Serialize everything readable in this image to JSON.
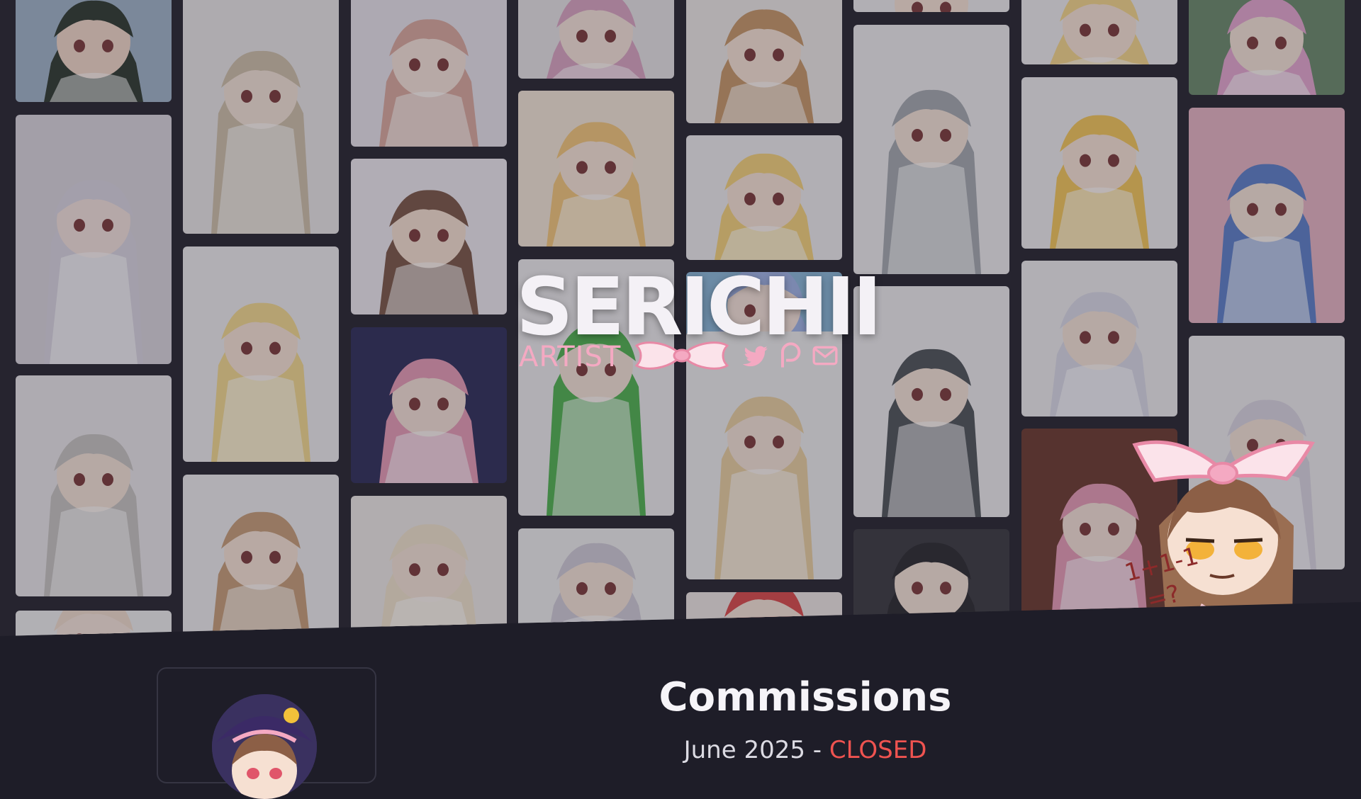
{
  "brand": {
    "name": "SERICHII",
    "role": "ARTIST",
    "colors": {
      "name": "#f4f1f6",
      "role": "#f4a9c2",
      "accent": "#f4a9c2"
    }
  },
  "social": [
    {
      "icon": "twitter-icon"
    },
    {
      "icon": "patreon-icon"
    },
    {
      "icon": "mail-icon"
    }
  ],
  "gallery": {
    "tiles": [
      {
        "bg": "#9fb4c8",
        "hair": "#2f3a30",
        "skin": "#f1d7c8"
      },
      {
        "bg": "#d8d5dc",
        "hair": "#d9d5e0",
        "skin": "#f3e1dc"
      },
      {
        "bg": "#e9e6e8",
        "hair": "#c6c3c0",
        "skin": "#f4e2d6"
      },
      {
        "bg": "#ececec",
        "hair": "#f0dccc",
        "skin": "#f5e4da"
      },
      {
        "bg": "#e8e5e6",
        "hair": "#cdbfa8",
        "skin": "#f3e2d6"
      },
      {
        "bg": "#ecebed",
        "hair": "#f2d98e",
        "skin": "#f6e3d4"
      },
      {
        "bg": "#ecebed",
        "hair": "#c69d77",
        "skin": "#f6e3d4"
      },
      {
        "bg": "#e7e3ea",
        "hair": "#d9a89c",
        "skin": "#f5e2d8"
      },
      {
        "bg": "#ece9ee",
        "hair": "#7a5747",
        "skin": "#f5e0d0"
      },
      {
        "bg": "#2e2e5a",
        "hair": "#e59bb5",
        "skin": "#f4e0d6"
      },
      {
        "bg": "#ece9e6",
        "hair": "#f0e2cc",
        "skin": "#f4e2d6"
      },
      {
        "bg": "#e6e2e4",
        "hair": "#d9a4c1",
        "skin": "#f5e2d8"
      },
      {
        "bg": "#f3e6d6",
        "hair": "#f2c67a",
        "skin": "#f6e4d6"
      },
      {
        "bg": "#ecebed",
        "hair": "#4fb24f",
        "skin": "#f4e2d6"
      },
      {
        "bg": "#ececec",
        "hair": "#cfcbd6",
        "skin": "#f4e2d6"
      },
      {
        "bg": "#ece8e6",
        "hair": "#c69768",
        "skin": "#f6e3d4"
      },
      {
        "bg": "#ecebed",
        "hair": "#f4d27a",
        "skin": "#f6e3d4"
      },
      {
        "bg": "#8ab8d8",
        "hair": "#9fb4e6",
        "skin": "#f5e2d8"
      },
      {
        "bg": "#ececec",
        "hair": "#e8cfa0",
        "skin": "#f4e2d6"
      },
      {
        "bg": "#ede6e2",
        "hair": "#d94a4a",
        "skin": "#f4e2d6"
      },
      {
        "bg": "#ecebed",
        "hair": "#f4d68a",
        "skin": "#f6e3d4"
      },
      {
        "bg": "#ecebed",
        "hair": "#a4a8ae",
        "skin": "#f4e2d6"
      },
      {
        "bg": "#ecebed",
        "hair": "#4e5358",
        "skin": "#f4e2d6"
      },
      {
        "bg": "#3a3a40",
        "hair": "#2a2a2e",
        "skin": "#f4e2d6"
      },
      {
        "bg": "#ecebed",
        "hair": "#f4d68a",
        "skin": "#f6e3d4"
      },
      {
        "bg": "#ecebed",
        "hair": "#f2c65a",
        "skin": "#f6e3d4"
      },
      {
        "bg": "#ecebed",
        "hair": "#d9d9e6",
        "skin": "#f4e2d6"
      },
      {
        "bg": "#6b3a2e",
        "hair": "#e59bb5",
        "skin": "#f4e0d6"
      },
      {
        "bg": "#6a8a6a",
        "hair": "#e4a6cf",
        "skin": "#f4e2d6"
      },
      {
        "bg": "#e6b4c2",
        "hair": "#5c7fc8",
        "skin": "#f4e2d6"
      },
      {
        "bg": "#ecebed",
        "hair": "#d9d5e0",
        "skin": "#f4e2d6"
      }
    ]
  },
  "commissions": {
    "title": "Commissions",
    "month": "June 2025",
    "separator": " - ",
    "status": "CLOSED",
    "colors": {
      "status": "#ef5350"
    }
  },
  "profile": {
    "avatar_icon": "avatar"
  }
}
